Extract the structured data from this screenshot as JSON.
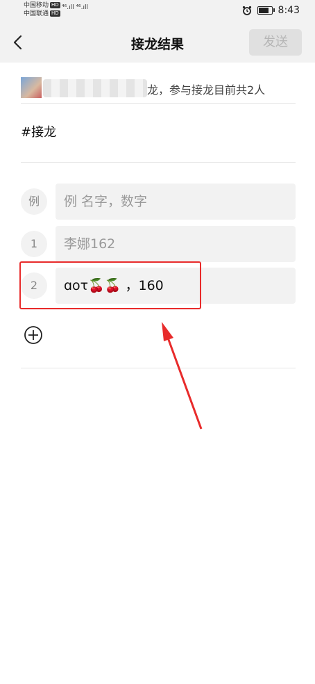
{
  "status_bar": {
    "carrier1": "中国移动",
    "carrier2": "中国联通",
    "hd_badge": "HD",
    "signal_text": "⁴⁶.ıll ⁴⁶.ıll",
    "alarm_icon": "alarm-icon",
    "time": "8:43"
  },
  "nav": {
    "title": "接龙结果",
    "send_label": "发送",
    "back_icon": "chevron-left-icon"
  },
  "info": {
    "text": "龙，参与接龙目前共2人"
  },
  "hashtag": "#接龙",
  "entries": [
    {
      "num": "例",
      "value": "例 名字，数字",
      "placeholder": true
    },
    {
      "num": "1",
      "value": "李娜162",
      "placeholder": true
    },
    {
      "num": "2",
      "value": "ɑoτ🍒🍒 ，160",
      "placeholder": false
    }
  ],
  "add_icon": "plus-circle-icon",
  "annotation_color": "#e82b2b"
}
